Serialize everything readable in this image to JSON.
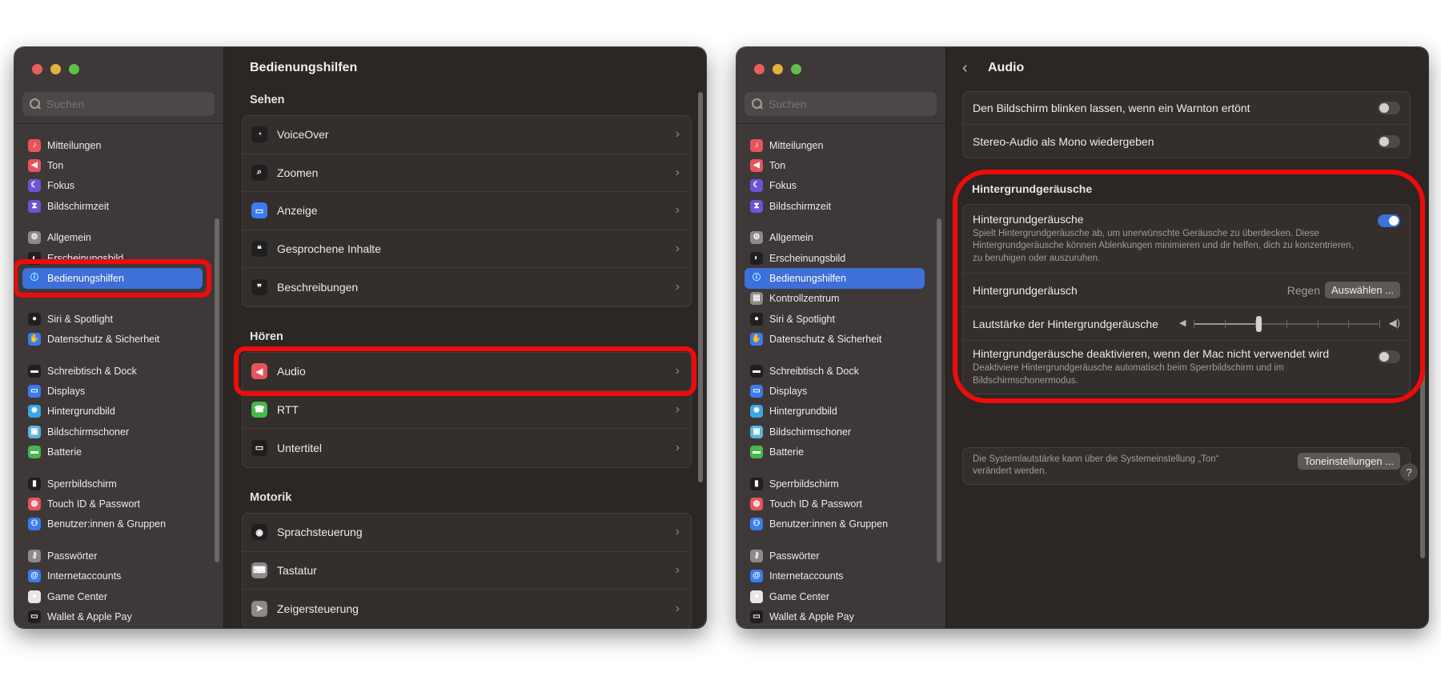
{
  "sidebar": {
    "search_placeholder": "Suchen",
    "groups": [
      [
        {
          "label": "Mitteilungen",
          "icon": "bell-icon",
          "color": "#e9545c"
        },
        {
          "label": "Ton",
          "icon": "speaker-icon",
          "color": "#e9545c"
        },
        {
          "label": "Fokus",
          "icon": "moon-icon",
          "color": "#6955d6"
        },
        {
          "label": "Bildschirmzeit",
          "icon": "hourglass-icon",
          "color": "#6955d6"
        }
      ],
      [
        {
          "label": "Allgemein",
          "icon": "gear-icon",
          "color": "#8e8a89"
        },
        {
          "label": "Erscheinungsbild",
          "icon": "appearance-icon",
          "color": "#1f1f1f"
        },
        {
          "label": "Bedienungshilfen",
          "icon": "accessibility-icon",
          "color": "#2f74e4"
        },
        {
          "label": "Kontrollzentrum",
          "icon": "control-center-icon",
          "color": "#8e8a89"
        },
        {
          "label": "Siri & Spotlight",
          "icon": "siri-icon",
          "color": "#1f1f1f"
        },
        {
          "label": "Datenschutz & Sicherheit",
          "icon": "hand-icon",
          "color": "#3a7cf0"
        }
      ],
      [
        {
          "label": "Schreibtisch & Dock",
          "icon": "dock-icon",
          "color": "#1f1f1f"
        },
        {
          "label": "Displays",
          "icon": "display-icon",
          "color": "#3a7cf0"
        },
        {
          "label": "Hintergrundbild",
          "icon": "wallpaper-icon",
          "color": "#3aa7e6"
        },
        {
          "label": "Bildschirmschoner",
          "icon": "screensaver-icon",
          "color": "#5ab6d8"
        },
        {
          "label": "Batterie",
          "icon": "battery-icon",
          "color": "#47b64f"
        }
      ],
      [
        {
          "label": "Sperrbildschirm",
          "icon": "lock-icon",
          "color": "#1f1f1f"
        },
        {
          "label": "Touch ID & Passwort",
          "icon": "fingerprint-icon",
          "color": "#e9545c"
        },
        {
          "label": "Benutzer:innen & Gruppen",
          "icon": "users-icon",
          "color": "#3a7cf0"
        }
      ],
      [
        {
          "label": "Passwörter",
          "icon": "key-icon",
          "color": "#8e8a89"
        },
        {
          "label": "Internetaccounts",
          "icon": "at-icon",
          "color": "#3a7cf0"
        },
        {
          "label": "Game Center",
          "icon": "game-center-icon",
          "color": "#e6e6e6"
        },
        {
          "label": "Wallet & Apple Pay",
          "icon": "wallet-icon",
          "color": "#1f1f1f"
        }
      ]
    ]
  },
  "left": {
    "title": "Bedienungshilfen",
    "sections": [
      {
        "title": "Sehen",
        "rows": [
          {
            "label": "VoiceOver",
            "icon": "voiceover-icon",
            "color": "#1f1f1f"
          },
          {
            "label": "Zoomen",
            "icon": "zoom-icon",
            "color": "#1f1f1f"
          },
          {
            "label": "Anzeige",
            "icon": "display-icon",
            "color": "#3a7cf0"
          },
          {
            "label": "Gesprochene Inhalte",
            "icon": "speech-bubble-icon",
            "color": "#1f1f1f"
          },
          {
            "label": "Beschreibungen",
            "icon": "descriptions-icon",
            "color": "#1f1f1f"
          }
        ]
      },
      {
        "title": "Hören",
        "rows": [
          {
            "label": "Audio",
            "icon": "speaker-icon",
            "color": "#e9545c"
          },
          {
            "label": "RTT",
            "icon": "rtt-icon",
            "color": "#47b64f"
          },
          {
            "label": "Untertitel",
            "icon": "subtitles-icon",
            "color": "#1f1f1f"
          }
        ]
      },
      {
        "title": "Motorik",
        "rows": [
          {
            "label": "Sprachsteuerung",
            "icon": "voice-control-icon",
            "color": "#1f1f1f"
          },
          {
            "label": "Tastatur",
            "icon": "keyboard-icon",
            "color": "#8e8a89"
          },
          {
            "label": "Zeigersteuerung",
            "icon": "pointer-icon",
            "color": "#8e8a89"
          }
        ]
      }
    ]
  },
  "right": {
    "title": "Audio",
    "top_rows": [
      {
        "label": "Den Bildschirm blinken lassen, wenn ein Warnton ertönt",
        "on": false
      },
      {
        "label": "Stereo-Audio als Mono wiedergeben",
        "on": false
      }
    ],
    "section_title": "Hintergrundgeräusche",
    "bg_toggle": {
      "label": "Hintergrundgeräusche",
      "desc": "Spielt Hintergrundgeräusche ab, um unerwünschte Geräusche zu überdecken. Diese Hintergrundgeräusche können Ablenkungen minimieren und dir helfen, dich zu konzentrieren, zu beruhigen oder auszuruhen.",
      "on": true
    },
    "bg_sound": {
      "label": "Hintergrundgeräusch",
      "value": "Regen",
      "button": "Auswählen ..."
    },
    "volume": {
      "label": "Lautstärke der Hintergrundgeräusche",
      "level": 0.35
    },
    "deactivate": {
      "label": "Hintergrundgeräusche deaktivieren, wenn der Mac nicht verwendet wird",
      "desc": "Deaktiviere Hintergrundgeräusche automatisch beim Sperrbildschirm und im Bildschirmschonermodus.",
      "on": false
    },
    "footer": {
      "text": "Die Systemlautstärke kann über die Systemeinstellung „Ton“ verändert werden.",
      "button": "Toneinstellungen ..."
    },
    "help": "?"
  },
  "colors": {
    "highlight": "#ee0b0b",
    "accent": "#3f6fd8"
  }
}
